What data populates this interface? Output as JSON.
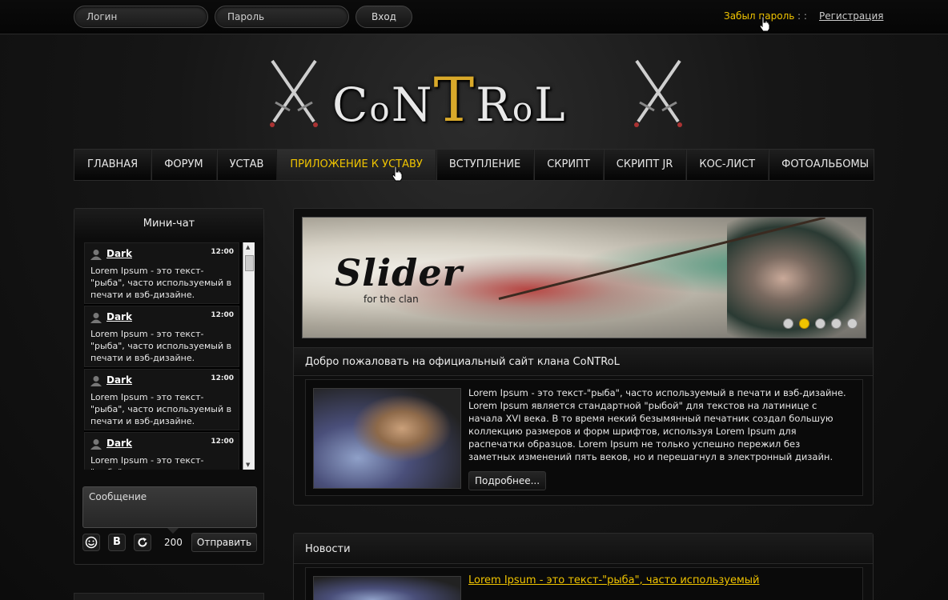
{
  "topbar": {
    "login_placeholder": "Логин",
    "password_placeholder": "Пароль",
    "login_button": "Вход",
    "forgot_password": "Забыл пароль",
    "separator": ": :",
    "register": "Регистрация"
  },
  "logo": {
    "letters": [
      "C",
      "o",
      "N",
      "T",
      "R",
      "o",
      "L"
    ]
  },
  "nav": {
    "items": [
      "ГЛАВНАЯ",
      "ФОРУМ",
      "УСТАВ",
      "ПРИЛОЖЕНИЕ К УСТАВУ",
      "ВСТУПЛЕНИЕ",
      "СКРИПТ",
      "СКРИПТ JR",
      "КОС-ЛИСТ",
      "ФОТОАЛЬБОМЫ"
    ],
    "active_index": 3
  },
  "minichat": {
    "title": "Мини-чат",
    "messages": [
      {
        "user": "Dark",
        "time": "12:00",
        "text": "Lorem Ipsum - это текст-\"рыба\", часто используемый в печати и вэб-дизайне."
      },
      {
        "user": "Dark",
        "time": "12:00",
        "text": "Lorem Ipsum - это текст-\"рыба\", часто используемый в печати и вэб-дизайне."
      },
      {
        "user": "Dark",
        "time": "12:00",
        "text": "Lorem Ipsum - это текст-\"рыба\", часто используемый в печати и вэб-дизайне."
      },
      {
        "user": "Dark",
        "time": "12:00",
        "text": "Lorem Ipsum - это текст-\"рыба\","
      }
    ],
    "message_placeholder": "Сообщение",
    "char_count": "200",
    "send_button": "Отправить",
    "icons": [
      "smiley-icon",
      "bold-icon",
      "refresh-icon"
    ]
  },
  "slider": {
    "title": "Slider",
    "subtitle": "for the clan",
    "dot_count": 5,
    "active_dot": 1
  },
  "welcome": {
    "title": "Добро пожаловать на официальный сайт клана CoNTRoL",
    "text": "Lorem Ipsum - это текст-\"рыба\", часто используемый в печати и вэб-дизайне. Lorem Ipsum является стандартной \"рыбой\" для текстов на латинице с начала XVI века. В то время некий безымянный печатник создал большую коллекцию размеров и форм шрифтов, используя Lorem Ipsum для распечатки образцов. Lorem Ipsum не только успешно пережил без заметных изменений пять веков, но и перешагнул в электронный дизайн.",
    "more_button": "Подробнее..."
  },
  "news": {
    "title": "Новости",
    "headline": "Lorem Ipsum - это текст-\"рыба\", часто используемый"
  },
  "colors": {
    "accent": "#f0c400",
    "background": "#111111"
  }
}
